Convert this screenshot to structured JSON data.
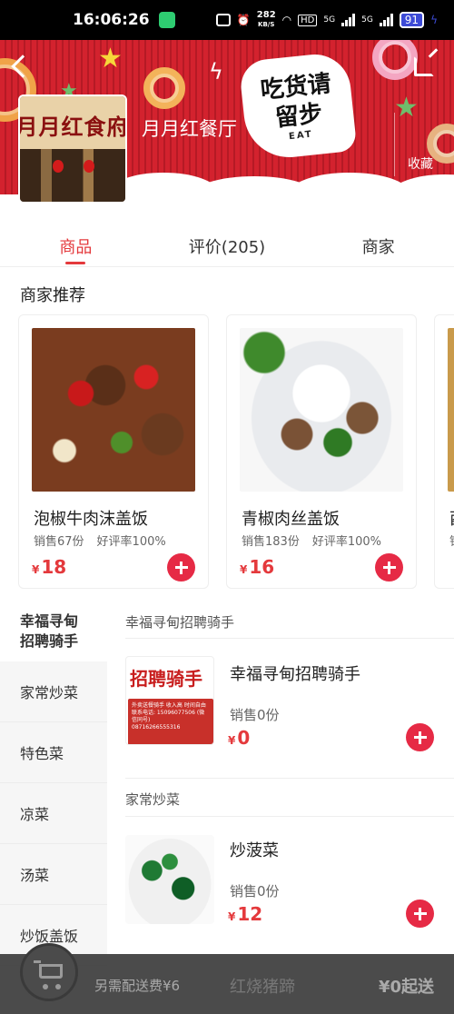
{
  "status_bar": {
    "time": "16:06:26",
    "net_speed_value": "282",
    "net_speed_unit": "KB/S",
    "hd_label": "HD",
    "sig1_label": "5G",
    "sig2_label": "5G",
    "battery": "91"
  },
  "shop": {
    "name": "月月红餐厅",
    "storefront_sign": "月月红食府",
    "logo_text": "吃货请留步",
    "logo_sub": "EAT",
    "favorite_label": "收藏"
  },
  "tabs": [
    {
      "label": "商品"
    },
    {
      "label": "评价(205)"
    },
    {
      "label": "商家"
    }
  ],
  "recommend": {
    "title": "商家推荐",
    "items": [
      {
        "name": "泡椒牛肉沫盖饭",
        "sales": "销售67份",
        "rating": "好评率100%",
        "currency": "¥",
        "price": "18"
      },
      {
        "name": "青椒肉丝盖饭",
        "sales": "销售183份",
        "rating": "好评率100%",
        "currency": "¥",
        "price": "16"
      },
      {
        "name": "酉",
        "sales": "销",
        "rating": "",
        "currency": "",
        "price": ""
      }
    ]
  },
  "categories": [
    {
      "label": "幸福寻甸招聘骑手"
    },
    {
      "label": "家常炒菜"
    },
    {
      "label": "特色菜"
    },
    {
      "label": "凉菜"
    },
    {
      "label": "汤菜"
    },
    {
      "label": "炒饭盖饭"
    }
  ],
  "menu_groups": [
    {
      "title": "幸福寻甸招聘骑手",
      "item": {
        "name": "幸福寻甸招聘骑手",
        "sales": "销售0份",
        "currency": "¥",
        "price": "0",
        "image_text": "招聘骑手",
        "image_sub": "外卖送餐骑手 收入高 时间自由",
        "image_phone_1": "联系电话: 15096077506 (微信同号)",
        "image_phone_2": "08716266555316"
      }
    },
    {
      "title": "家常炒菜",
      "item": {
        "name": "炒菠菜",
        "sales": "销售0份",
        "currency": "¥",
        "price": "12"
      }
    }
  ],
  "next_item_peek": "红烧猪蹄",
  "cart": {
    "delivery_note": "另需配送费¥6",
    "min_order": "¥0起送"
  }
}
